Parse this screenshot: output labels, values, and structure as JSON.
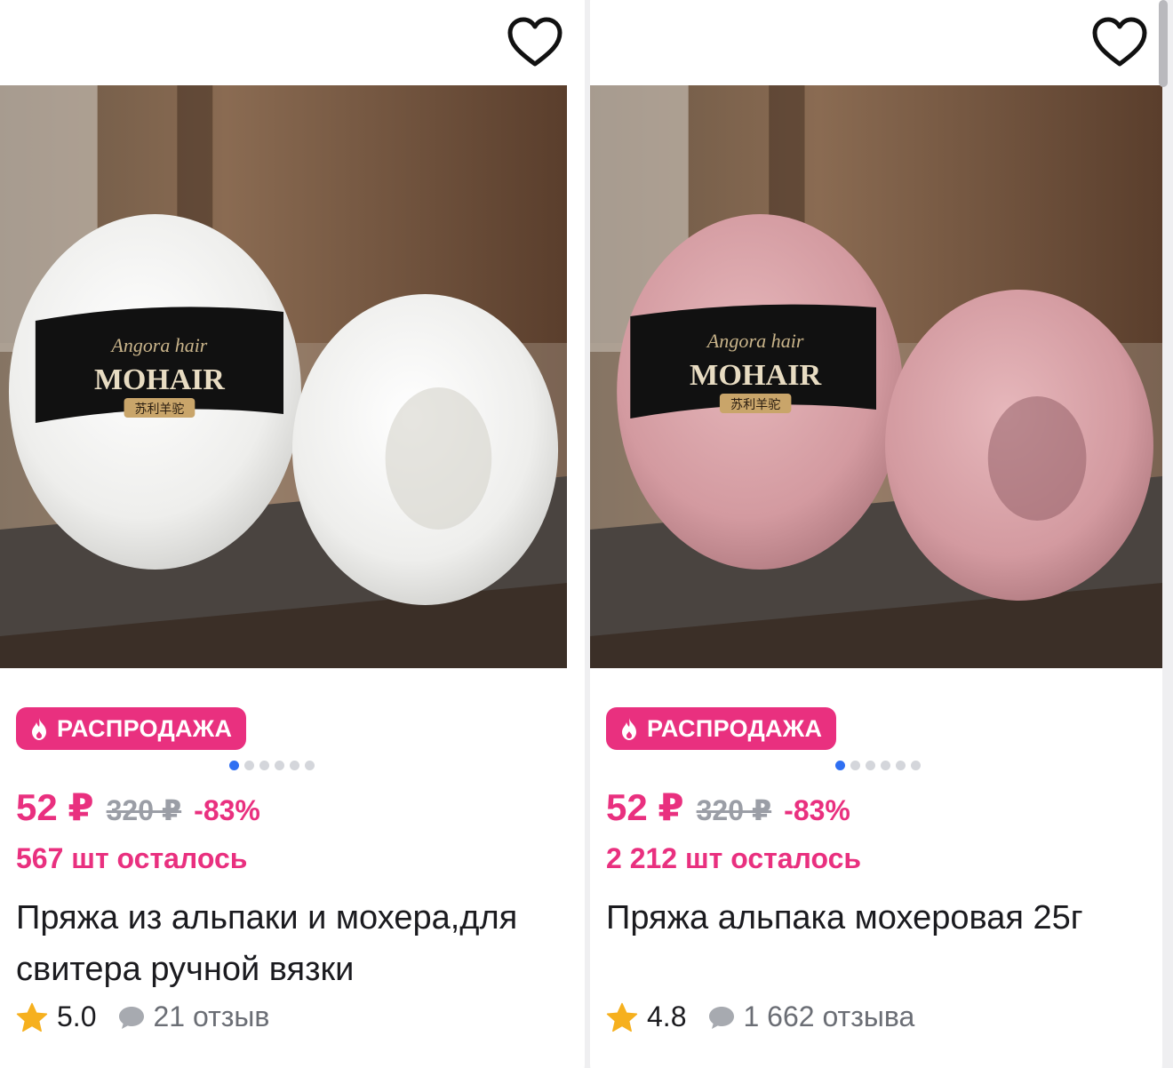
{
  "products": [
    {
      "badge": "РАСПРОДАЖА",
      "price": "52 ₽",
      "old_price": "320 ₽",
      "discount": "-83%",
      "stock": "567 шт осталось",
      "title": "Пряжа из альпаки и мохера,для свитера ручной вязки",
      "rating": "5.0",
      "reviews": "21 отзыв",
      "label_brand": "MOHAIR",
      "label_script": "Angora hair",
      "label_cn": "苏利羊驼",
      "yarn_color": "#f4f4f2",
      "slide_count": 6,
      "active_slide": 0
    },
    {
      "badge": "РАСПРОДАЖА",
      "price": "52 ₽",
      "old_price": "320 ₽",
      "discount": "-83%",
      "stock": "2 212 шт осталось",
      "title": "Пряжа альпака мохеровая 25г",
      "rating": "4.8",
      "reviews": "1 662 отзыва",
      "label_brand": "MOHAIR",
      "label_script": "Angora hair",
      "label_cn": "苏利羊驼",
      "yarn_color": "#d9a0a6",
      "slide_count": 6,
      "active_slide": 0
    }
  ],
  "colors": {
    "accent": "#e9307f",
    "dot_active": "#2f6ff2",
    "star": "#f6b01e"
  }
}
